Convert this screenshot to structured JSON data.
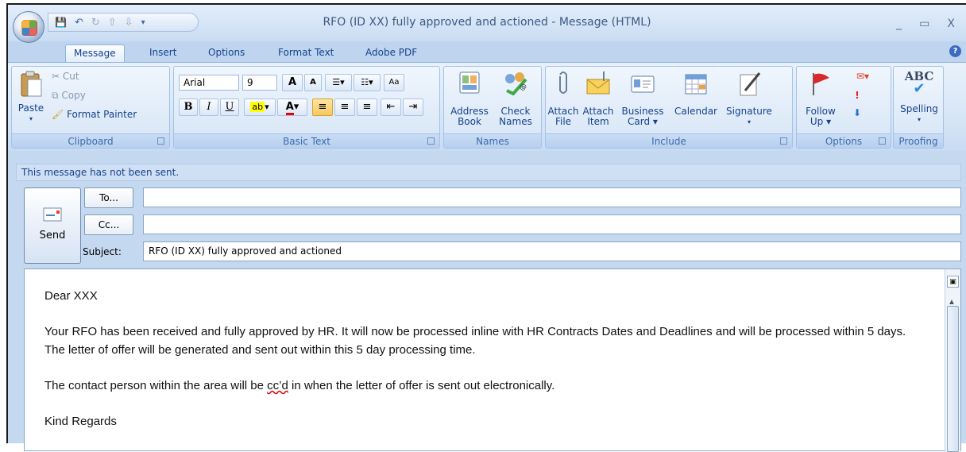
{
  "window": {
    "title": "RFO (ID XX) fully approved and actioned - Message (HTML)",
    "controls": [
      "_",
      "▭",
      "X"
    ]
  },
  "qat": {
    "save": "💾",
    "undo": "↶",
    "redo": "↻",
    "up": "⇧",
    "down": "⇩",
    "more": "▾"
  },
  "tabs": [
    "Message",
    "Insert",
    "Options",
    "Format Text",
    "Adobe PDF"
  ],
  "ribbon": {
    "clipboard": {
      "label": "Clipboard",
      "paste": "Paste",
      "cut": "Cut",
      "copy": "Copy",
      "format_painter": "Format Painter"
    },
    "basic_text": {
      "label": "Basic Text",
      "font": "Arial",
      "size": "9",
      "bold": "B",
      "italic": "I",
      "underline": "U",
      "grow": "A",
      "shrink": "A"
    },
    "names": {
      "label": "Names",
      "address_book_1": "Address",
      "address_book_2": "Book",
      "check_names_1": "Check",
      "check_names_2": "Names"
    },
    "include": {
      "label": "Include",
      "attach_file_1": "Attach",
      "attach_file_2": "File",
      "attach_item_1": "Attach",
      "attach_item_2": "Item",
      "business_card_1": "Business",
      "business_card_2": "Card ▾",
      "calendar": "Calendar",
      "signature": "Signature"
    },
    "options": {
      "label": "Options",
      "follow_up_1": "Follow",
      "follow_up_2": "Up ▾"
    },
    "proofing": {
      "label": "Proofing",
      "spelling": "Spelling",
      "abc": "ABC"
    }
  },
  "compose": {
    "info": "This message has not been sent.",
    "send": "Send",
    "to_button": "To...",
    "cc_button": "Cc...",
    "subject_label": "Subject:",
    "to_value": "",
    "cc_value": "",
    "subject_value": "RFO (ID XX) fully approved and actioned",
    "body": {
      "greeting": "Dear XXX",
      "para1": "Your RFO has been received and fully approved by HR.  It will now be processed inline with HR Contracts Dates and Deadlines and will be processed within 5 days.  The letter of offer will be generated and sent out within this 5 day processing time.",
      "para2_a": "The contact person within the area will be ",
      "para2_b": "cc’d",
      "para2_c": " in when the letter of offer is sent out electronically.",
      "closing": "Kind Regards"
    }
  },
  "colors": {
    "ribbon": "#d4e4f6",
    "title_text": "#3b5a82",
    "accent": "#15428b"
  }
}
